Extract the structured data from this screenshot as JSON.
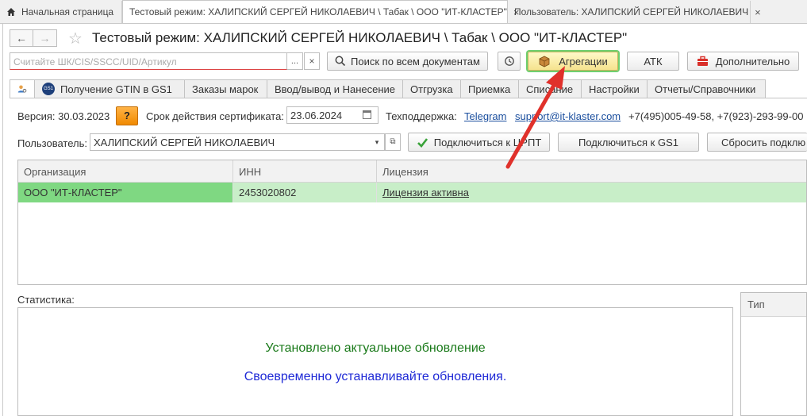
{
  "top_tabs": [
    {
      "label": "Начальная страница"
    },
    {
      "label": "Тестовый режим:  ХАЛИПСКИЙ СЕРГЕЙ НИКОЛАЕВИЧ \\ Табак \\ ООО \"ИТ-КЛАСТЕР\""
    },
    {
      "label": "Пользователь: ХАЛИПСКИЙ СЕРГЕЙ НИКОЛАЕВИЧ"
    }
  ],
  "header": {
    "title": "Тестовый режим:  ХАЛИПСКИЙ СЕРГЕЙ НИКОЛАЕВИЧ \\ Табак \\ ООО \"ИТ-КЛАСТЕР\""
  },
  "toolbar": {
    "search_placeholder": "Считайте ШК/CIS/SSCC/UID/Артикул",
    "search_dots": "...",
    "search_all": "Поиск по всем документам",
    "aggregations": "Агрегации",
    "atk": "АТК",
    "additional": "Дополнительно"
  },
  "function_tabs": [
    {
      "label": "Получение GTIN в GS1"
    },
    {
      "label": "Заказы марок"
    },
    {
      "label": "Ввод/вывод и Нанесение"
    },
    {
      "label": "Отгрузка"
    },
    {
      "label": "Приемка"
    },
    {
      "label": "Списание"
    },
    {
      "label": "Настройки"
    },
    {
      "label": "Отчеты/Справочники"
    }
  ],
  "info": {
    "version": "Версия: 30.03.2023",
    "help": "?",
    "cert_label": "Срок действия сертификата:",
    "cert_date": "23.06.2024",
    "support_label": "Техподдержка:",
    "telegram": "Telegram",
    "email": "support@it-klaster.com",
    "phones": "+7(495)005-49-58, +7(923)-293-99-00"
  },
  "user_row": {
    "label": "Пользователь:",
    "value": "ХАЛИПСКИЙ СЕРГЕЙ НИКОЛАЕВИЧ",
    "connect_crpt": "Подключиться к ЦРПТ",
    "connect_gs1": "Подключиться к GS1",
    "reset": "Сбросить подклю"
  },
  "table": {
    "columns": [
      "Организация",
      "ИНН",
      "Лицензия"
    ],
    "rows": [
      {
        "org": "ООО \"ИТ-КЛАСТЕР\"",
        "inn": "2453020802",
        "license": "Лицензия активна"
      }
    ]
  },
  "stats": {
    "label": "Статистика:",
    "msg_updated": "Установлено актуальное обновление",
    "msg_advice": "Своевременно устанавливайте обновления."
  },
  "type_panel": {
    "header": "Тип"
  },
  "colors": {
    "row_green": "#c8eec8",
    "highlight_green": "#6fcf6f",
    "arrow_red": "#e0312b"
  }
}
